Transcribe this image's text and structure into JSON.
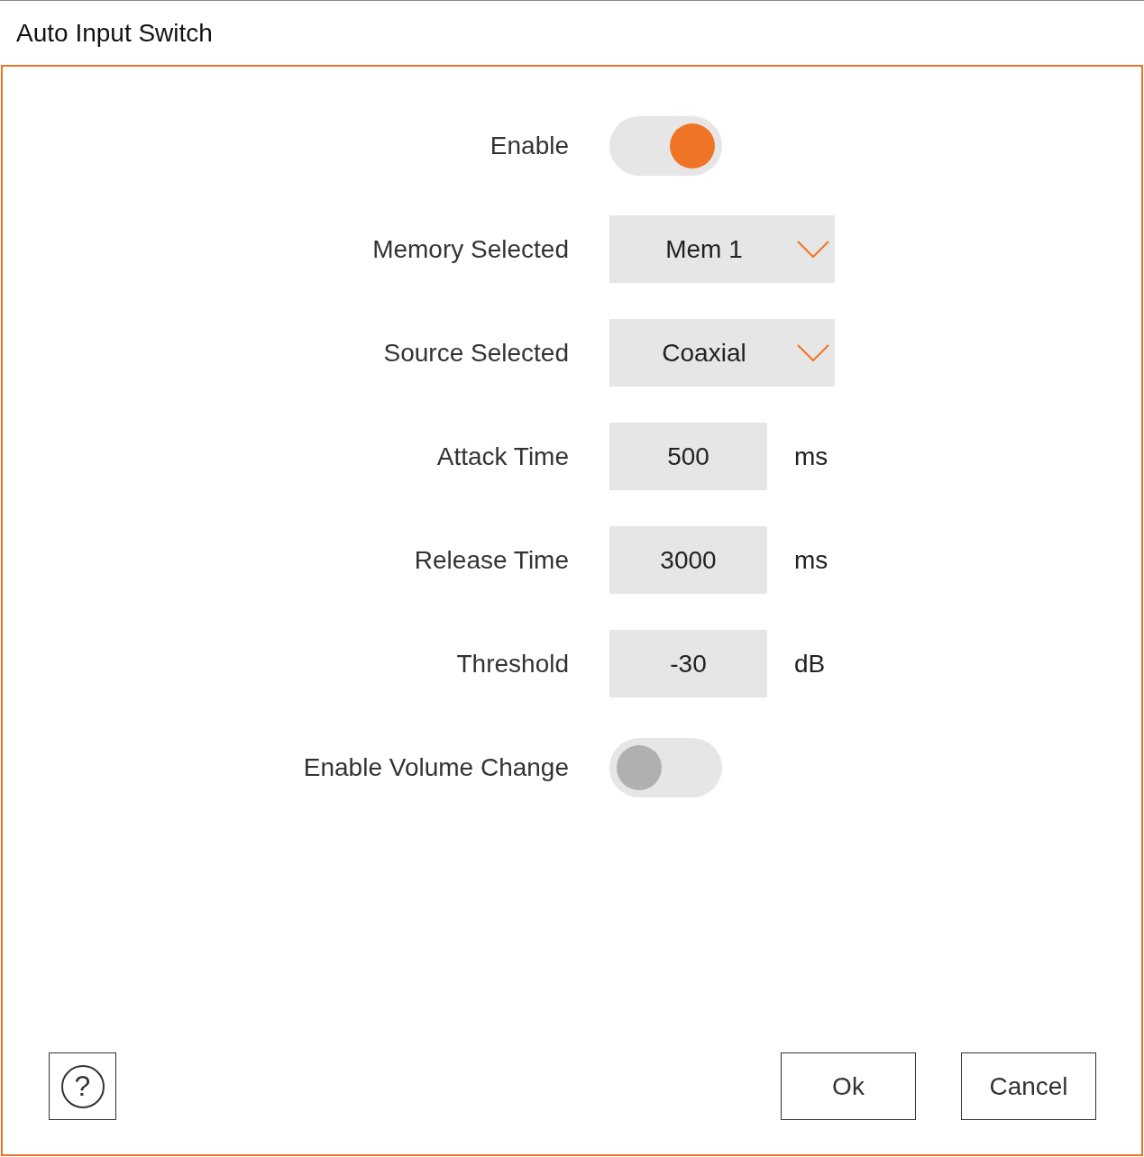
{
  "window": {
    "title": "Auto Input Switch"
  },
  "settings": [
    {
      "kind": "toggle",
      "label": "Enable",
      "on": true
    },
    {
      "kind": "dropdown",
      "label": "Memory Selected",
      "value": "Mem 1"
    },
    {
      "kind": "dropdown",
      "label": "Source Selected",
      "value": "Coaxial"
    },
    {
      "kind": "number",
      "label": "Attack Time",
      "value": "500",
      "unit": "ms"
    },
    {
      "kind": "number",
      "label": "Release Time",
      "value": "3000",
      "unit": "ms"
    },
    {
      "kind": "number",
      "label": "Threshold",
      "value": "-30",
      "unit": "dB"
    },
    {
      "kind": "toggle",
      "label": "Enable Volume Change",
      "on": false
    }
  ],
  "help_button": {
    "label": "?"
  },
  "buttons": [
    "Ok",
    "Cancel"
  ]
}
